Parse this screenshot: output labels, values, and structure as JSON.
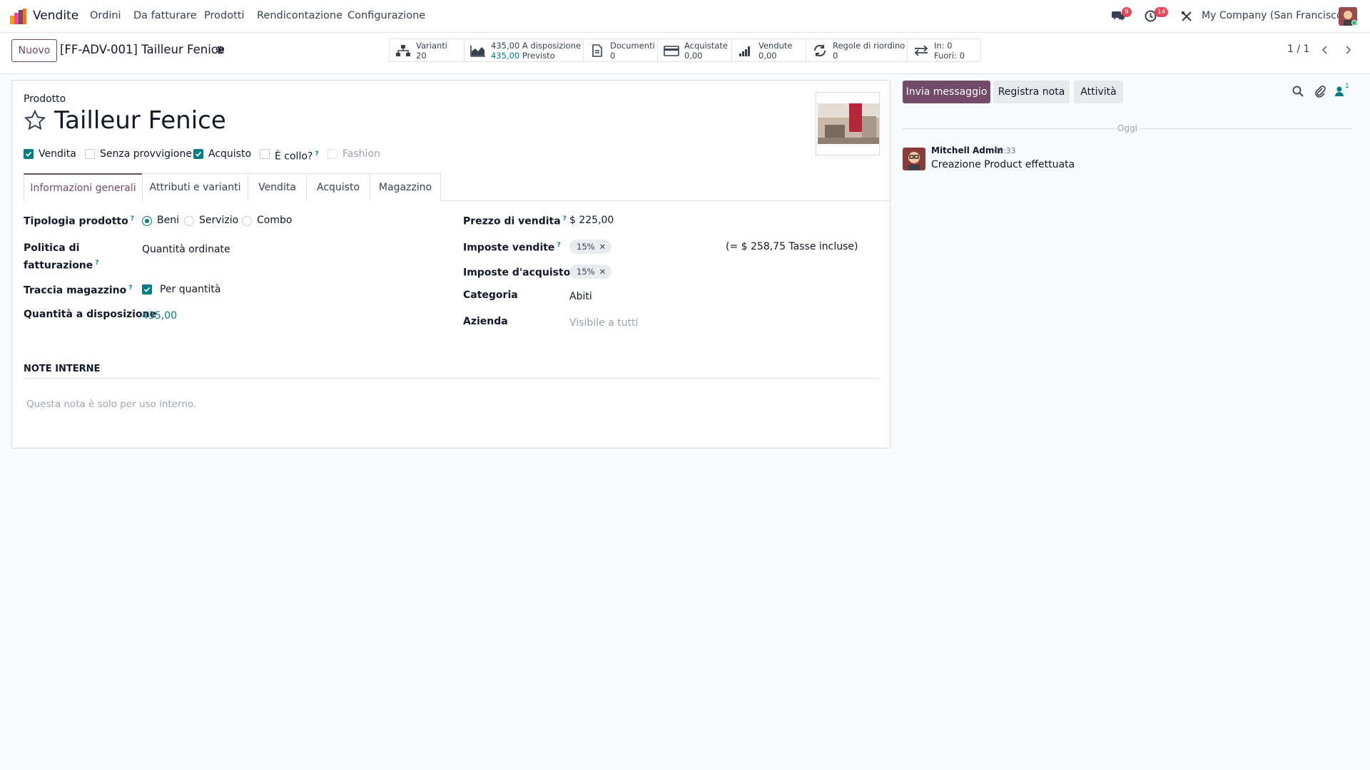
{
  "navbar": {
    "app_name": "Vendite",
    "menu": [
      "Ordini",
      "Da fatturare",
      "Prodotti",
      "Rendicontazione",
      "Configurazione"
    ],
    "messages_count": "9",
    "activities_count": "14",
    "company": "My Company (San Francisco)"
  },
  "control_panel": {
    "new_label": "Nuovo",
    "breadcrumb": "[FF-ADV-001] Tailleur Fenice",
    "pager": "1 / 1",
    "stats": [
      {
        "label": "Varianti",
        "value": "20"
      },
      {
        "label": "435,00 A disposizione",
        "value": "435,00",
        "value_suffix": "Previsto"
      },
      {
        "label": "Documenti",
        "value": "0"
      },
      {
        "label": "Acquistate",
        "value": "0,00"
      },
      {
        "label": "Vendute",
        "value": "0,00"
      },
      {
        "label": "Regole di riordino",
        "value": "0"
      },
      {
        "label": "In: 0",
        "value": "Fuori: 0"
      }
    ]
  },
  "form": {
    "product_label": "Prodotto",
    "product_name": "Tailleur Fenice",
    "flags": [
      {
        "label": "Vendita",
        "checked": true
      },
      {
        "label": "Senza provvigione",
        "checked": false
      },
      {
        "label": "Acquisto",
        "checked": true
      },
      {
        "label": "È collo?",
        "checked": false
      },
      {
        "label": "Fashion",
        "checked": false
      }
    ],
    "tabs": [
      "Informazioni generali",
      "Attributi e varianti",
      "Vendita",
      "Acquisto",
      "Magazzino"
    ],
    "product_type_label": "Tipologia prodotto",
    "product_type_options": [
      "Beni",
      "Servizio",
      "Combo"
    ],
    "invoice_policy_label_1": "Politica di",
    "invoice_policy_label_2": "fatturazione",
    "invoice_policy_value": "Quantità ordinate",
    "track_inventory_label": "Traccia magazzino",
    "track_inventory_value": "Per quantità",
    "qty_label": "Quantità a disposizione",
    "qty_value": "435,00",
    "sale_price_label": "Prezzo di vendita",
    "sale_price_value": "$ 225,00",
    "sale_taxes_label": "Imposte vendite",
    "sale_taxes_tag": "15%",
    "taxes_included": "(= $ 258,75 Tasse incluse)",
    "purchase_taxes_label": "Imposte d'acquisto",
    "purchase_taxes_tag": "15%",
    "category_label": "Categoria",
    "category_value": "Abiti",
    "company_label": "Azienda",
    "company_placeholder": "Visibile a tutti",
    "notes_title": "NOTE INTERNE",
    "notes_placeholder": "Questa nota è solo per uso interno."
  },
  "chatter": {
    "send_message": "Invia messaggio",
    "log_note": "Registra nota",
    "activities": "Attività",
    "followers_count": "1",
    "date_separator": "Oggi",
    "message": {
      "author": "Mitchell Admin",
      "time": "09:33",
      "body": "Creazione Product effettuata"
    }
  },
  "colors": {
    "brand": "#714b67",
    "accent": "#017e84",
    "badge": "#e4485a"
  }
}
